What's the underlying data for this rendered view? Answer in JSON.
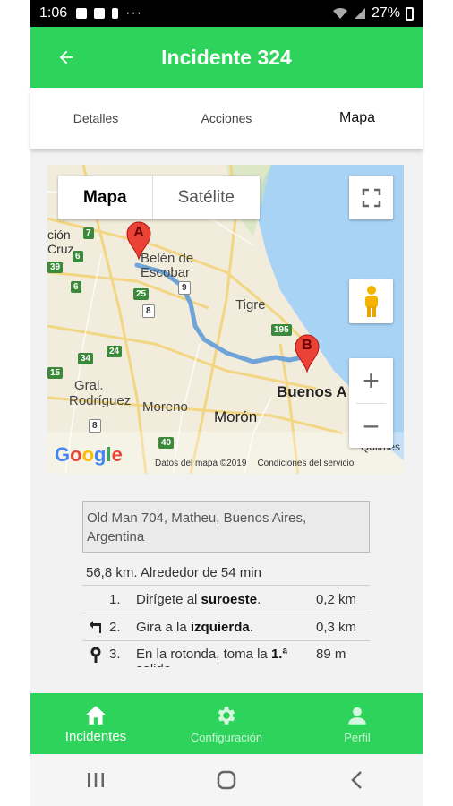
{
  "status_bar": {
    "time": "1:06",
    "battery": "27%",
    "dots": "···"
  },
  "app_bar": {
    "title": "Incidente 324"
  },
  "tabs": [
    {
      "label": "Detalles",
      "active": false
    },
    {
      "label": "Acciones",
      "active": false
    },
    {
      "label": "Mapa",
      "active": true
    }
  ],
  "map": {
    "type_map": "Mapa",
    "type_satellite": "Satélite",
    "zoom_in": "+",
    "zoom_out": "−",
    "google": "Google",
    "data_label": "Datos del mapa ©2019",
    "terms_label": "Condiciones del servicio",
    "marker_a": "A",
    "marker_b": "B",
    "labels": {
      "belen": "Belén de",
      "escobar": "Escobar",
      "tigre": "Tigre",
      "buenos_aires": "Buenos A",
      "moreno": "Moreno",
      "moron": "Morón",
      "gral": "Gral.",
      "rodriguez": "Rodríguez",
      "cion": "ción",
      "cruz": "Cruz",
      "quilmes": "Quilmes"
    },
    "shields": [
      "7",
      "6",
      "39",
      "6",
      "25",
      "8",
      "9",
      "195",
      "34",
      "24",
      "40",
      "8",
      "15"
    ]
  },
  "address": "Old Man 704, Matheu, Buenos Aires, Argentina",
  "route_summary": "56,8 km. Alrededor de 54 min",
  "steps": [
    {
      "num": "1.",
      "text_pre": "Dirígete al ",
      "text_bold": "suroeste",
      "text_post": ".",
      "dist": "0,2 km"
    },
    {
      "num": "2.",
      "text_pre": "Gira a la ",
      "text_bold": "izquierda",
      "text_post": ".",
      "dist": "0,3 km"
    },
    {
      "num": "3.",
      "text_pre": "En la rotonda, toma la ",
      "text_bold": "1.ª",
      "text_post": " salida",
      "dist": "89 m"
    }
  ],
  "bottom_nav": [
    {
      "label": "Incidentes",
      "active": true
    },
    {
      "label": "Configuración",
      "active": false
    },
    {
      "label": "Perfil",
      "active": false
    }
  ],
  "colors": {
    "primary": "#2ed35c",
    "route": "#6fa4d9",
    "water": "#a9d3f5",
    "marker": "#ea4335"
  }
}
